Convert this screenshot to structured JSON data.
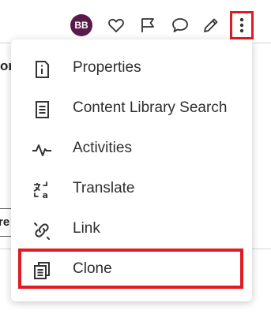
{
  "background": {
    "fragment_top": "or",
    "fragment_field": "re"
  },
  "toolbar": {
    "avatar_initials": "BB",
    "avatar_color": "#5a1a4a",
    "icons": [
      "heart-icon",
      "flag-icon",
      "comment-icon",
      "pencil-icon",
      "more-vertical-icon"
    ],
    "highlight_color": "#e01b23"
  },
  "menu": {
    "items": [
      {
        "label": "Properties",
        "icon": "info-icon"
      },
      {
        "label": "Content Library Search",
        "icon": "document-list-icon"
      },
      {
        "label": "Activities",
        "icon": "activity-pulse-icon"
      },
      {
        "label": "Translate",
        "icon": "translate-icon"
      },
      {
        "label": "Link",
        "icon": "link-icon"
      },
      {
        "label": "Clone",
        "icon": "clone-icon"
      }
    ],
    "highlighted_item": "Clone"
  }
}
